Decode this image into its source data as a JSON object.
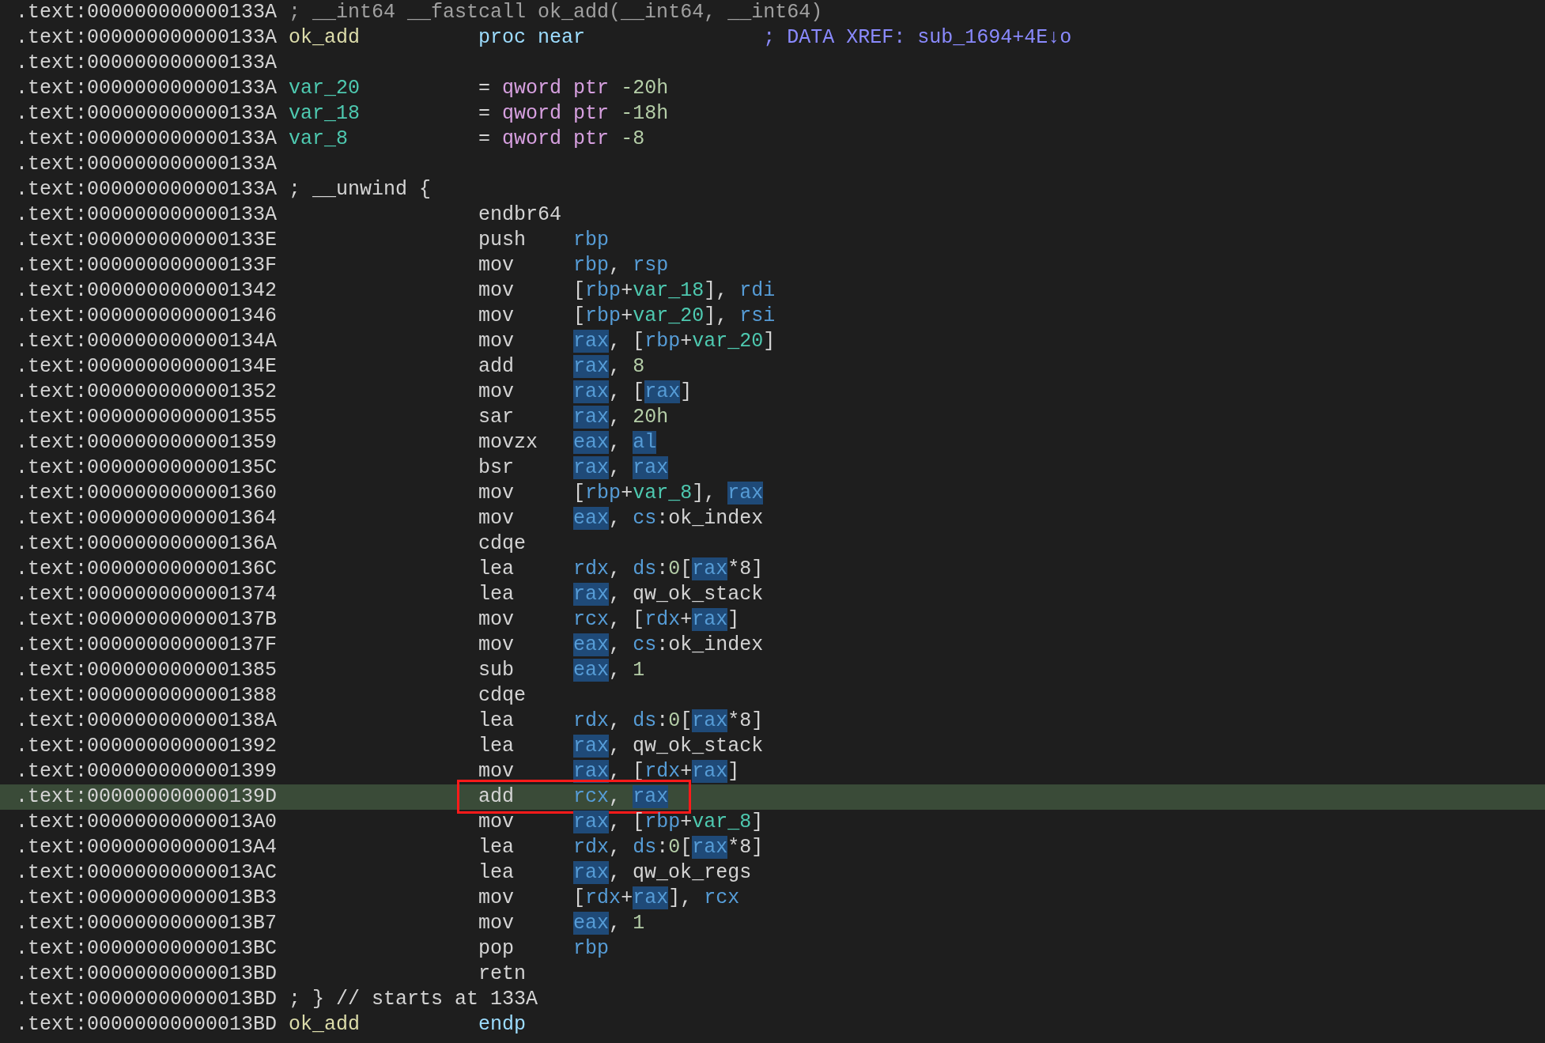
{
  "lines": [
    {
      "address": ".text:000000000000133A",
      "comment": {
        "text": "; __int64 __fastcall ok_add(__int64, __int64)",
        "kind": "signature"
      },
      "selected": false
    },
    {
      "address": ".text:000000000000133A",
      "label": {
        "text": "ok_add",
        "kind": "function"
      },
      "directive": "proc near",
      "comment": {
        "text": "; DATA XREF: sub_1694+4E↓o",
        "kind": "xref"
      },
      "selected": false
    },
    {
      "address": ".text:000000000000133A",
      "selected": false
    },
    {
      "address": ".text:000000000000133A",
      "label": {
        "text": "var_20",
        "kind": "variable"
      },
      "operands": [
        {
          "text": "=",
          "kind": "text"
        },
        {
          "text": " qword ptr",
          "kind": "type"
        },
        {
          "text": " -20h",
          "kind": "num"
        }
      ],
      "selected": false
    },
    {
      "address": ".text:000000000000133A",
      "label": {
        "text": "var_18",
        "kind": "variable"
      },
      "operands": [
        {
          "text": "=",
          "kind": "text"
        },
        {
          "text": " qword ptr",
          "kind": "type"
        },
        {
          "text": " -18h",
          "kind": "num"
        }
      ],
      "selected": false
    },
    {
      "address": ".text:000000000000133A",
      "label": {
        "text": "var_8",
        "kind": "variable"
      },
      "operands": [
        {
          "text": "=",
          "kind": "text"
        },
        {
          "text": " qword ptr",
          "kind": "type"
        },
        {
          "text": " -8",
          "kind": "num"
        }
      ],
      "selected": false
    },
    {
      "address": ".text:000000000000133A",
      "selected": false
    },
    {
      "address": ".text:000000000000133A",
      "comment": {
        "text": "; __unwind {",
        "kind": "plain"
      },
      "selected": false
    },
    {
      "address": ".text:000000000000133A",
      "mnemonic": "endbr64",
      "selected": false
    },
    {
      "address": ".text:000000000000133E",
      "mnemonic": "push",
      "operands": [
        {
          "text": "rbp",
          "kind": "reg",
          "highlighted": false
        }
      ],
      "selected": false
    },
    {
      "address": ".text:000000000000133F",
      "mnemonic": "mov",
      "operands": [
        {
          "text": "rbp",
          "kind": "reg",
          "highlighted": false
        },
        {
          "text": ", ",
          "kind": "text"
        },
        {
          "text": "rsp",
          "kind": "reg",
          "highlighted": false
        }
      ],
      "selected": false
    },
    {
      "address": ".text:0000000000001342",
      "mnemonic": "mov",
      "operands": [
        {
          "text": "[",
          "kind": "text"
        },
        {
          "text": "rbp",
          "kind": "reg",
          "highlighted": false
        },
        {
          "text": "+",
          "kind": "text"
        },
        {
          "text": "var_18",
          "kind": "var"
        },
        {
          "text": "], ",
          "kind": "text"
        },
        {
          "text": "rdi",
          "kind": "reg",
          "highlighted": false
        }
      ],
      "selected": false
    },
    {
      "address": ".text:0000000000001346",
      "mnemonic": "mov",
      "operands": [
        {
          "text": "[",
          "kind": "text"
        },
        {
          "text": "rbp",
          "kind": "reg",
          "highlighted": false
        },
        {
          "text": "+",
          "kind": "text"
        },
        {
          "text": "var_20",
          "kind": "var"
        },
        {
          "text": "], ",
          "kind": "text"
        },
        {
          "text": "rsi",
          "kind": "reg",
          "highlighted": false
        }
      ],
      "selected": false
    },
    {
      "address": ".text:000000000000134A",
      "mnemonic": "mov",
      "operands": [
        {
          "text": "rax",
          "kind": "reg",
          "highlighted": true
        },
        {
          "text": ", [",
          "kind": "text"
        },
        {
          "text": "rbp",
          "kind": "reg",
          "highlighted": false
        },
        {
          "text": "+",
          "kind": "text"
        },
        {
          "text": "var_20",
          "kind": "var"
        },
        {
          "text": "]",
          "kind": "text"
        }
      ],
      "selected": false
    },
    {
      "address": ".text:000000000000134E",
      "mnemonic": "add",
      "operands": [
        {
          "text": "rax",
          "kind": "reg",
          "highlighted": true
        },
        {
          "text": ", ",
          "kind": "text"
        },
        {
          "text": "8",
          "kind": "num"
        }
      ],
      "selected": false
    },
    {
      "address": ".text:0000000000001352",
      "mnemonic": "mov",
      "operands": [
        {
          "text": "rax",
          "kind": "reg",
          "highlighted": true
        },
        {
          "text": ", [",
          "kind": "text"
        },
        {
          "text": "rax",
          "kind": "reg",
          "highlighted": true
        },
        {
          "text": "]",
          "kind": "text"
        }
      ],
      "selected": false
    },
    {
      "address": ".text:0000000000001355",
      "mnemonic": "sar",
      "operands": [
        {
          "text": "rax",
          "kind": "reg",
          "highlighted": true
        },
        {
          "text": ", ",
          "kind": "text"
        },
        {
          "text": "20h",
          "kind": "num"
        }
      ],
      "selected": false
    },
    {
      "address": ".text:0000000000001359",
      "mnemonic": "movzx",
      "operands": [
        {
          "text": "eax",
          "kind": "reg",
          "highlighted": true
        },
        {
          "text": ", ",
          "kind": "text"
        },
        {
          "text": "al",
          "kind": "reg",
          "highlighted": true
        }
      ],
      "selected": false
    },
    {
      "address": ".text:000000000000135C",
      "mnemonic": "bsr",
      "operands": [
        {
          "text": "rax",
          "kind": "reg",
          "highlighted": true
        },
        {
          "text": ", ",
          "kind": "text"
        },
        {
          "text": "rax",
          "kind": "reg",
          "highlighted": true
        }
      ],
      "selected": false
    },
    {
      "address": ".text:0000000000001360",
      "mnemonic": "mov",
      "operands": [
        {
          "text": "[",
          "kind": "text"
        },
        {
          "text": "rbp",
          "kind": "reg",
          "highlighted": false
        },
        {
          "text": "+",
          "kind": "text"
        },
        {
          "text": "var_8",
          "kind": "var"
        },
        {
          "text": "], ",
          "kind": "text"
        },
        {
          "text": "rax",
          "kind": "reg",
          "highlighted": true
        }
      ],
      "selected": false
    },
    {
      "address": ".text:0000000000001364",
      "mnemonic": "mov",
      "operands": [
        {
          "text": "eax",
          "kind": "reg",
          "highlighted": true
        },
        {
          "text": ", ",
          "kind": "text"
        },
        {
          "text": "cs",
          "kind": "reg",
          "highlighted": false
        },
        {
          "text": ":ok_index",
          "kind": "text"
        }
      ],
      "selected": false
    },
    {
      "address": ".text:000000000000136A",
      "mnemonic": "cdqe",
      "selected": false
    },
    {
      "address": ".text:000000000000136C",
      "mnemonic": "lea",
      "operands": [
        {
          "text": "rdx",
          "kind": "reg",
          "highlighted": false
        },
        {
          "text": ", ",
          "kind": "text"
        },
        {
          "text": "ds",
          "kind": "reg",
          "highlighted": false
        },
        {
          "text": ":",
          "kind": "text"
        },
        {
          "text": "0",
          "kind": "num"
        },
        {
          "text": "[",
          "kind": "text"
        },
        {
          "text": "rax",
          "kind": "reg",
          "highlighted": true
        },
        {
          "text": "*8]",
          "kind": "text"
        }
      ],
      "selected": false
    },
    {
      "address": ".text:0000000000001374",
      "mnemonic": "lea",
      "operands": [
        {
          "text": "rax",
          "kind": "reg",
          "highlighted": true
        },
        {
          "text": ", qw_ok_stack",
          "kind": "text"
        }
      ],
      "selected": false
    },
    {
      "address": ".text:000000000000137B",
      "mnemonic": "mov",
      "operands": [
        {
          "text": "rcx",
          "kind": "reg",
          "highlighted": false
        },
        {
          "text": ", [",
          "kind": "text"
        },
        {
          "text": "rdx",
          "kind": "reg",
          "highlighted": false
        },
        {
          "text": "+",
          "kind": "text"
        },
        {
          "text": "rax",
          "kind": "reg",
          "highlighted": true
        },
        {
          "text": "]",
          "kind": "text"
        }
      ],
      "selected": false
    },
    {
      "address": ".text:000000000000137F",
      "mnemonic": "mov",
      "operands": [
        {
          "text": "eax",
          "kind": "reg",
          "highlighted": true
        },
        {
          "text": ", ",
          "kind": "text"
        },
        {
          "text": "cs",
          "kind": "reg",
          "highlighted": false
        },
        {
          "text": ":ok_index",
          "kind": "text"
        }
      ],
      "selected": false
    },
    {
      "address": ".text:0000000000001385",
      "mnemonic": "sub",
      "operands": [
        {
          "text": "eax",
          "kind": "reg",
          "highlighted": true
        },
        {
          "text": ", ",
          "kind": "text"
        },
        {
          "text": "1",
          "kind": "num"
        }
      ],
      "selected": false
    },
    {
      "address": ".text:0000000000001388",
      "mnemonic": "cdqe",
      "selected": false
    },
    {
      "address": ".text:000000000000138A",
      "mnemonic": "lea",
      "operands": [
        {
          "text": "rdx",
          "kind": "reg",
          "highlighted": false
        },
        {
          "text": ", ",
          "kind": "text"
        },
        {
          "text": "ds",
          "kind": "reg",
          "highlighted": false
        },
        {
          "text": ":",
          "kind": "text"
        },
        {
          "text": "0",
          "kind": "num"
        },
        {
          "text": "[",
          "kind": "text"
        },
        {
          "text": "rax",
          "kind": "reg",
          "highlighted": true
        },
        {
          "text": "*8]",
          "kind": "text"
        }
      ],
      "selected": false
    },
    {
      "address": ".text:0000000000001392",
      "mnemonic": "lea",
      "operands": [
        {
          "text": "rax",
          "kind": "reg",
          "highlighted": true
        },
        {
          "text": ", qw_ok_stack",
          "kind": "text"
        }
      ],
      "selected": false
    },
    {
      "address": ".text:0000000000001399",
      "mnemonic": "mov",
      "operands": [
        {
          "text": "rax",
          "kind": "reg",
          "highlighted": true
        },
        {
          "text": ", [",
          "kind": "text"
        },
        {
          "text": "rdx",
          "kind": "reg",
          "highlighted": false
        },
        {
          "text": "+",
          "kind": "text"
        },
        {
          "text": "rax",
          "kind": "reg",
          "highlighted": true
        },
        {
          "text": "]",
          "kind": "text"
        }
      ],
      "selected": false
    },
    {
      "address": ".text:000000000000139D",
      "mnemonic": "add",
      "operands": [
        {
          "text": "rcx",
          "kind": "reg",
          "highlighted": false
        },
        {
          "text": ", ",
          "kind": "text"
        },
        {
          "text": "rax",
          "kind": "reg",
          "highlighted": true
        }
      ],
      "selected": true,
      "boxed": true
    },
    {
      "address": ".text:00000000000013A0",
      "mnemonic": "mov",
      "operands": [
        {
          "text": "rax",
          "kind": "reg",
          "highlighted": true
        },
        {
          "text": ", [",
          "kind": "text"
        },
        {
          "text": "rbp",
          "kind": "reg",
          "highlighted": false
        },
        {
          "text": "+",
          "kind": "text"
        },
        {
          "text": "var_8",
          "kind": "var"
        },
        {
          "text": "]",
          "kind": "text"
        }
      ],
      "selected": false
    },
    {
      "address": ".text:00000000000013A4",
      "mnemonic": "lea",
      "operands": [
        {
          "text": "rdx",
          "kind": "reg",
          "highlighted": false
        },
        {
          "text": ", ",
          "kind": "text"
        },
        {
          "text": "ds",
          "kind": "reg",
          "highlighted": false
        },
        {
          "text": ":",
          "kind": "text"
        },
        {
          "text": "0",
          "kind": "num"
        },
        {
          "text": "[",
          "kind": "text"
        },
        {
          "text": "rax",
          "kind": "reg",
          "highlighted": true
        },
        {
          "text": "*8]",
          "kind": "text"
        }
      ],
      "selected": false
    },
    {
      "address": ".text:00000000000013AC",
      "mnemonic": "lea",
      "operands": [
        {
          "text": "rax",
          "kind": "reg",
          "highlighted": true
        },
        {
          "text": ", qw_ok_regs",
          "kind": "text"
        }
      ],
      "selected": false
    },
    {
      "address": ".text:00000000000013B3",
      "mnemonic": "mov",
      "operands": [
        {
          "text": "[",
          "kind": "text"
        },
        {
          "text": "rdx",
          "kind": "reg",
          "highlighted": false
        },
        {
          "text": "+",
          "kind": "text"
        },
        {
          "text": "rax",
          "kind": "reg",
          "highlighted": true
        },
        {
          "text": "], ",
          "kind": "text"
        },
        {
          "text": "rcx",
          "kind": "reg",
          "highlighted": false
        }
      ],
      "selected": false
    },
    {
      "address": ".text:00000000000013B7",
      "mnemonic": "mov",
      "operands": [
        {
          "text": "eax",
          "kind": "reg",
          "highlighted": true
        },
        {
          "text": ", ",
          "kind": "text"
        },
        {
          "text": "1",
          "kind": "num"
        }
      ],
      "selected": false
    },
    {
      "address": ".text:00000000000013BC",
      "mnemonic": "pop",
      "operands": [
        {
          "text": "rbp",
          "kind": "reg",
          "highlighted": false
        }
      ],
      "selected": false
    },
    {
      "address": ".text:00000000000013BD",
      "mnemonic": "retn",
      "selected": false
    },
    {
      "address": ".text:00000000000013BD",
      "comment": {
        "text": "; } // starts at 133A",
        "kind": "plain"
      },
      "selected": false
    },
    {
      "address": ".text:00000000000013BD",
      "label": {
        "text": "ok_add",
        "kind": "function"
      },
      "directive": "endp",
      "selected": false
    }
  ]
}
